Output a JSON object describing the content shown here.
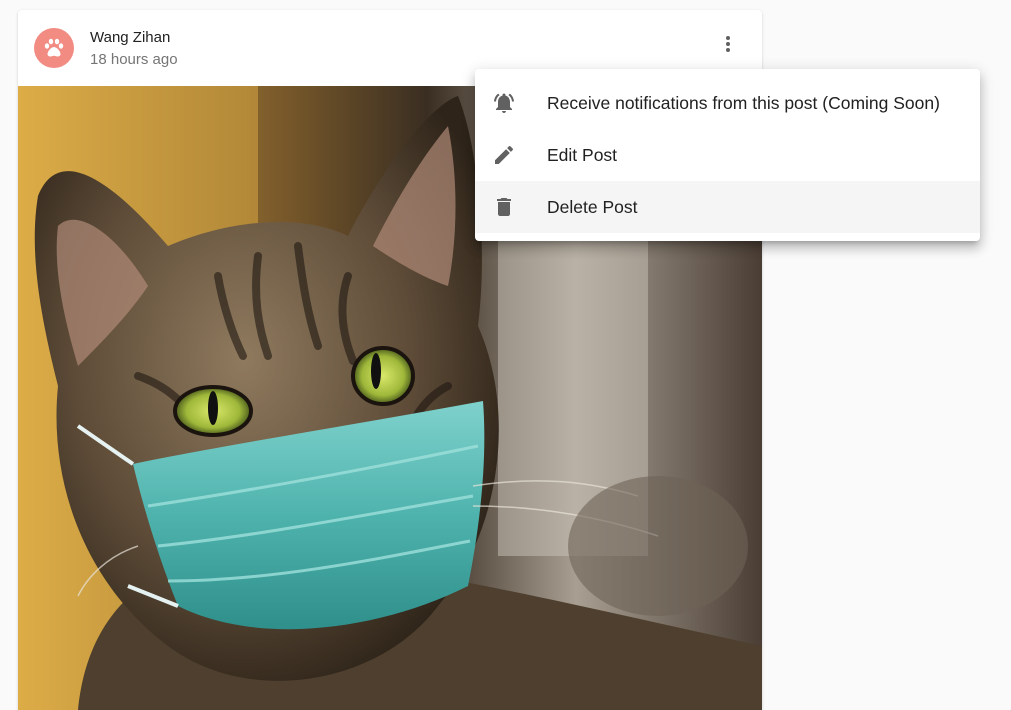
{
  "post": {
    "author": "Wang Zihan",
    "time": "18 hours ago",
    "avatar_icon": "paw-icon",
    "avatar_color": "#f28b82",
    "more_icon": "more-vert-icon",
    "photo_subject": "tabby cat wearing a surgical face mask"
  },
  "menu": {
    "items": [
      {
        "label": "Receive notifications from this post (Coming Soon)",
        "icon": "notifications-active-icon"
      },
      {
        "label": "Edit Post",
        "icon": "edit-pencil-icon"
      },
      {
        "label": "Delete Post",
        "icon": "delete-trash-icon"
      }
    ],
    "hovered_item": "Delete Post"
  }
}
